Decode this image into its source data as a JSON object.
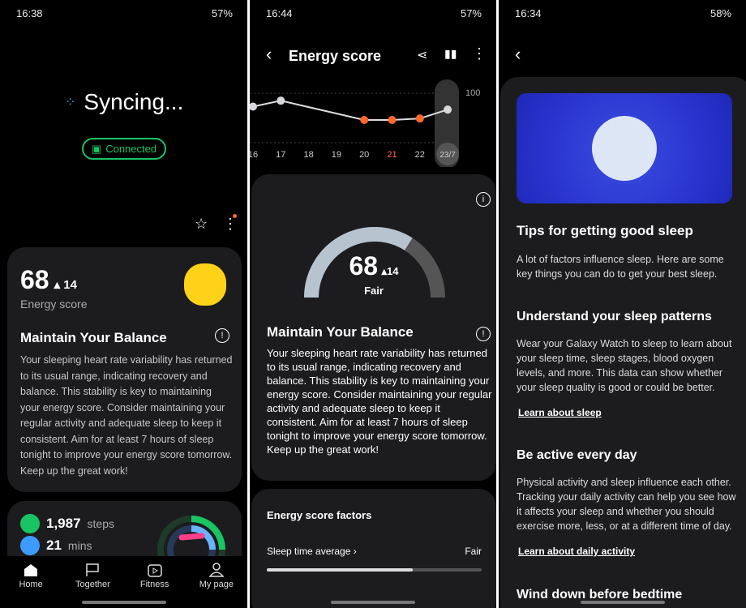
{
  "panel1": {
    "status": {
      "time": "16:38",
      "battery": "57%"
    },
    "sync_label": "Syncing...",
    "connected": "Connected",
    "score": "68",
    "delta": "14",
    "score_label": "Energy score",
    "title": "Maintain Your Balance",
    "body": "Your sleeping heart rate variability has returned to its usual range, indicating recovery and balance. This stability is key to maintaining your energy score. Consider maintaining your regular activity and adequate sleep to keep it consistent. Aim for at least 7 hours of sleep tonight to improve your energy score tomorrow. Keep up the great work!",
    "steps": "1,987",
    "steps_unit": "steps",
    "mins": "21",
    "mins_unit": "mins",
    "nav": [
      {
        "label": "Home",
        "icon": "home-icon"
      },
      {
        "label": "Together",
        "icon": "flag-icon"
      },
      {
        "label": "Fitness",
        "icon": "fitness-icon"
      },
      {
        "label": "My page",
        "icon": "person-icon"
      }
    ]
  },
  "panel2": {
    "status": {
      "time": "16:44",
      "battery": "57%"
    },
    "title": "Energy score",
    "y_max": "100",
    "chart_data": {
      "type": "line",
      "categories": [
        "16",
        "17",
        "18",
        "19",
        "20",
        "21",
        "22",
        "23/7"
      ],
      "values": [
        85,
        89,
        null,
        null,
        76,
        76,
        77,
        83
      ],
      "ylim": [
        0,
        100
      ],
      "highlight": "21",
      "point_colors": [
        "#d8d8dc",
        "#d8d8dc",
        null,
        null,
        "#ff6a2b",
        "#ff6a2b",
        "#ff6a2b",
        "#d8d8dc"
      ]
    },
    "score": "68",
    "delta": "14",
    "rating": "Fair",
    "gauge_fraction": 0.68,
    "card_title": "Maintain Your Balance",
    "body": "Your sleeping heart rate variability has returned to its usual range, indicating recovery and balance. This stability is key to maintaining your energy score. Consider maintaining your regular activity and adequate sleep to keep it consistent. Aim for at least 7 hours of sleep tonight to improve your energy score tomorrow. Keep up the great work!",
    "factors_title": "Energy score factors",
    "factor": "Sleep time average",
    "factor_value": "Fair",
    "factor_fraction": 0.68
  },
  "panel3": {
    "status": {
      "time": "16:34",
      "battery": "58%"
    },
    "tips_title": "Tips for getting good sleep",
    "tips_body": "A lot of factors influence sleep. Here are some key things you can do to get your best sleep.",
    "s1_title": "Understand your sleep patterns",
    "s1_body": "Wear your Galaxy Watch to sleep to learn about your sleep time, sleep stages, blood oxygen levels, and more. This data can show whether your sleep quality is good or could be better.",
    "s1_link": "Learn about sleep",
    "s2_title": "Be active every day",
    "s2_body": "Physical activity and sleep influence each other. Tracking your daily activity can help you see how it affects your sleep and whether you should exercise more, less, or at a different time of day.",
    "s2_link": "Learn about daily activity",
    "s3_title": "Wind down before bedtime"
  }
}
